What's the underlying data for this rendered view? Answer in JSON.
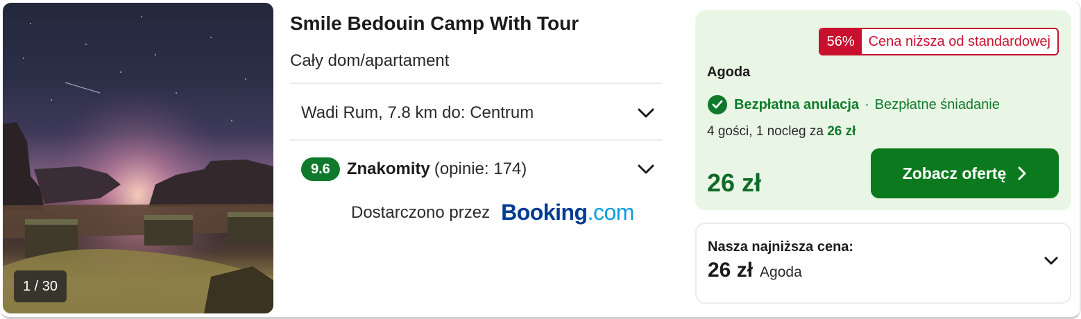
{
  "photo": {
    "counter": "1 / 30"
  },
  "hotel": {
    "name": "Smile Bedouin Camp With Tour",
    "type": "Cały dom/apartament",
    "location": "Wadi Rum, 7.8 km do: Centrum",
    "score": "9.6",
    "rating_word": "Znakomity",
    "rating_count": "(opinie: 174)",
    "provided_by": "Dostarczono przez",
    "source_logo": {
      "part1": "Booking",
      "part2": ".com"
    }
  },
  "deal": {
    "discount_pct": "56%",
    "discount_label": "Cena niższa od standardowej",
    "provider": "Agoda",
    "perk_main": "Bezpłatna anulacja",
    "perk_sep": "·",
    "perk_alt": "Bezpłatne śniadanie",
    "guests_text": "4 gości, 1 nocleg za",
    "guests_price": "26 zł",
    "price": "26 zł",
    "cta_label": "Zobacz ofertę"
  },
  "lowest": {
    "label": "Nasza najniższa cena:",
    "price": "26 zł",
    "provider": "Agoda"
  },
  "colors": {
    "accent_green": "#0f7a2c",
    "deal_bg": "#eaf6e5",
    "discount_red": "#c8102e",
    "booking_dark": "#003b95",
    "booking_light": "#0a9ce0"
  }
}
